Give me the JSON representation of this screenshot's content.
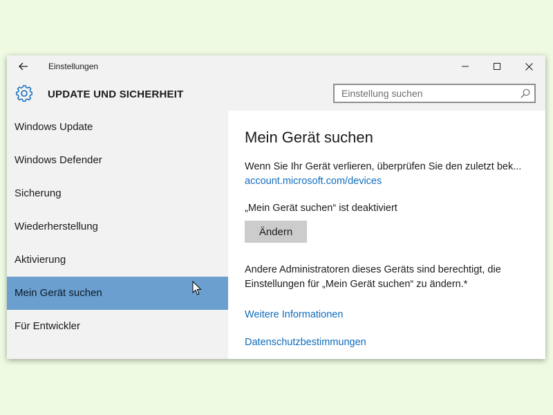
{
  "window": {
    "title": "Einstellungen"
  },
  "header": {
    "title": "UPDATE UND SICHERHEIT",
    "search_placeholder": "Einstellung suchen"
  },
  "sidebar": {
    "items": [
      {
        "label": "Windows Update",
        "selected": false
      },
      {
        "label": "Windows Defender",
        "selected": false
      },
      {
        "label": "Sicherung",
        "selected": false
      },
      {
        "label": "Wiederherstellung",
        "selected": false
      },
      {
        "label": "Aktivierung",
        "selected": false
      },
      {
        "label": "Mein Gerät suchen",
        "selected": true
      },
      {
        "label": "Für Entwickler",
        "selected": false
      }
    ]
  },
  "main": {
    "title": "Mein Gerät suchen",
    "description": "Wenn Sie Ihr Gerät verlieren, überprüfen Sie den zuletzt bek...",
    "devices_link": "account.microsoft.com/devices",
    "status": "„Mein Gerät suchen“ ist deaktiviert",
    "change_button": "Ändern",
    "admin_line1": "Andere Administratoren dieses Geräts sind berechtigt, die",
    "admin_line2": "Einstellungen für „Mein Gerät suchen“ zu ändern.*",
    "more_info_link": "Weitere Informationen",
    "privacy_link": "Datenschutzbestimmungen"
  },
  "colors": {
    "accent": "#0f6cbd",
    "selected_item": "#6a9fcf",
    "chrome": "#f2f2f2",
    "desktop": "#eefbe2"
  },
  "icons": {
    "back": "arrow-left-icon",
    "minimize": "minimize-icon",
    "maximize": "maximize-icon",
    "close": "close-icon",
    "settings": "gear-icon",
    "search": "search-icon",
    "cursor": "mouse-pointer-icon"
  }
}
